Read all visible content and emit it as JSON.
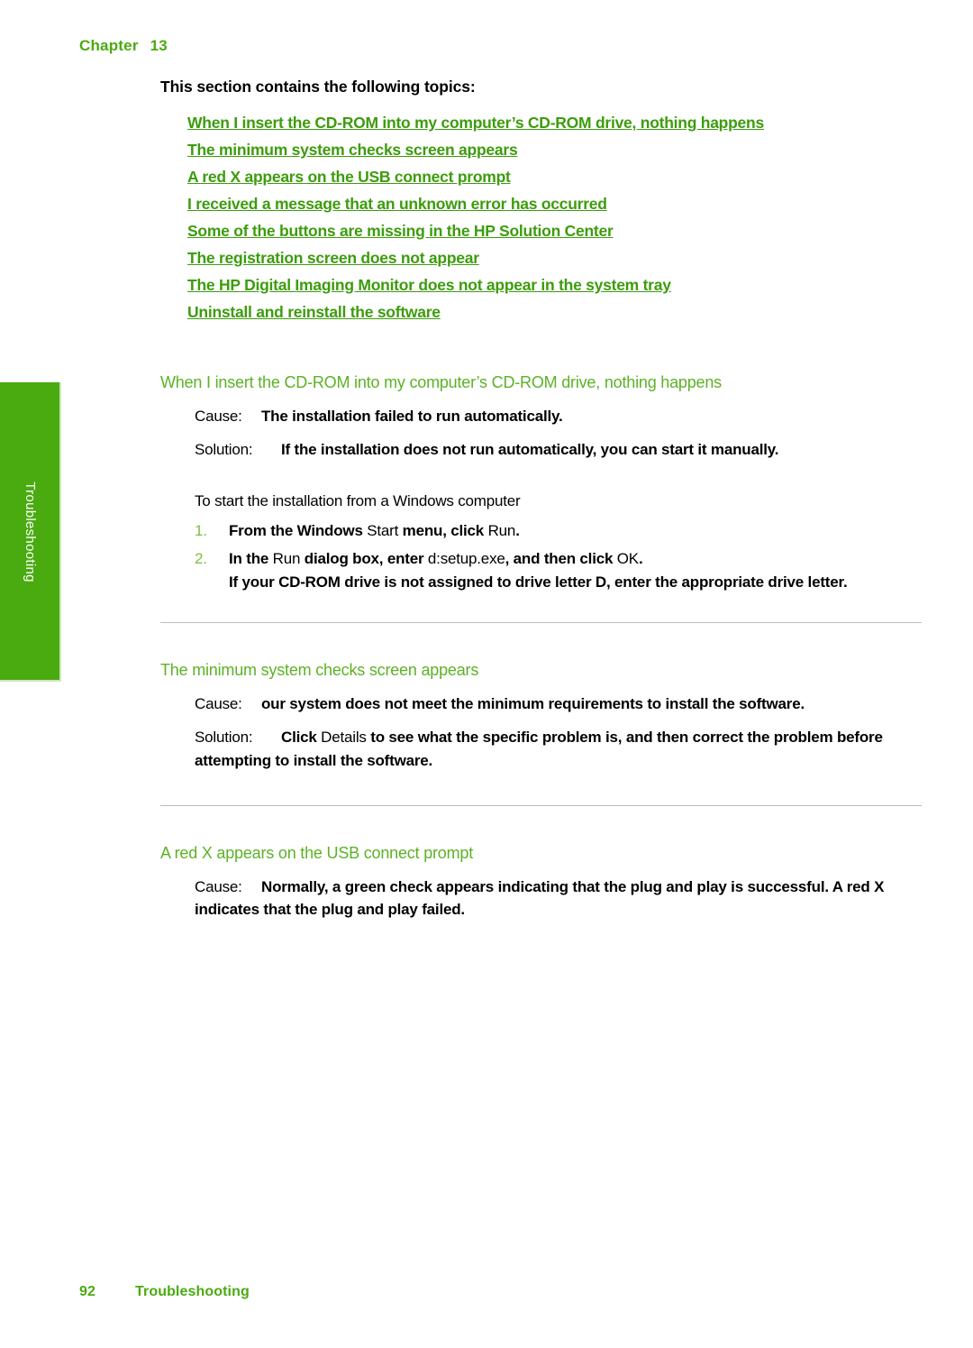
{
  "header": {
    "chapter_label": "Chapter",
    "chapter_number": "13"
  },
  "side_tab": {
    "label": "Troubleshooting",
    "background_color": "#4aab10",
    "text_color": "#ffffff"
  },
  "colors": {
    "link_green": "#3d9c0d",
    "heading_green": "#5cb226",
    "accent_green": "#4aab10",
    "list_number_green": "#7cbf3a",
    "rule_gray": "#bdbdbd"
  },
  "main": {
    "intro_heading": "This section contains the following topics:",
    "toc": [
      {
        "label": "When I insert the CD-ROM into my computer’s CD-ROM drive, nothing happens"
      },
      {
        "label": "The minimum system checks screen appears"
      },
      {
        "label": "A red X appears on the USB connect prompt"
      },
      {
        "label": "I received a message that an unknown error has occurred"
      },
      {
        "label": "Some of the buttons are missing in the HP Solution Center"
      },
      {
        "label": "The registration screen does not appear"
      },
      {
        "label": "The HP Digital Imaging Monitor does not appear in the system tray"
      },
      {
        "label": "Uninstall and reinstall the software"
      }
    ],
    "sections": [
      {
        "heading": "When I insert the CD-ROM into my computer’s CD-ROM drive, nothing happens",
        "cause_label": "Cause:",
        "cause_text": "The installation failed to run automatically.",
        "solution_label": "Solution:",
        "solution_text": "If the installation does not run automatically, you can start it manually.",
        "procedure_title": "To start the installation from a Windows computer",
        "steps": [
          {
            "parts": [
              {
                "text": "From the Windows ",
                "style": "bold"
              },
              {
                "text": "Start",
                "style": "ui"
              },
              {
                "text": " menu, click ",
                "style": "bold"
              },
              {
                "text": "Run",
                "style": "ui"
              },
              {
                "text": ".",
                "style": "bold"
              }
            ]
          },
          {
            "parts": [
              {
                "text": "In the ",
                "style": "bold"
              },
              {
                "text": "Run",
                "style": "ui"
              },
              {
                "text": " dialog box, enter ",
                "style": "bold"
              },
              {
                "text": "d:setup.exe",
                "style": "ui"
              },
              {
                "text": ", and then click ",
                "style": "bold"
              },
              {
                "text": "OK",
                "style": "ui"
              },
              {
                "text": ".",
                "style": "bold"
              }
            ],
            "sub_text": "If your CD-ROM drive is not assigned to drive letter D, enter the appropriate drive letter."
          }
        ]
      },
      {
        "heading": "The minimum system checks screen appears",
        "cause_label": "Cause:",
        "cause_text": "our system does not meet the minimum requirements to install the software.",
        "solution_label": "Solution:",
        "solution_parts": [
          {
            "text": "Click ",
            "style": "bold"
          },
          {
            "text": "Details",
            "style": "ui"
          },
          {
            "text": " to see what the specific problem is, and then correct the problem before attempting to install the software.",
            "style": "bold"
          }
        ]
      },
      {
        "heading": "A red X appears on the USB connect prompt",
        "cause_label": "Cause:",
        "cause_text": "Normally, a green check appears indicating that the plug and play is successful. A red X indicates that the plug and play failed."
      }
    ]
  },
  "footer": {
    "page_number": "92",
    "section_name": "Troubleshooting"
  }
}
